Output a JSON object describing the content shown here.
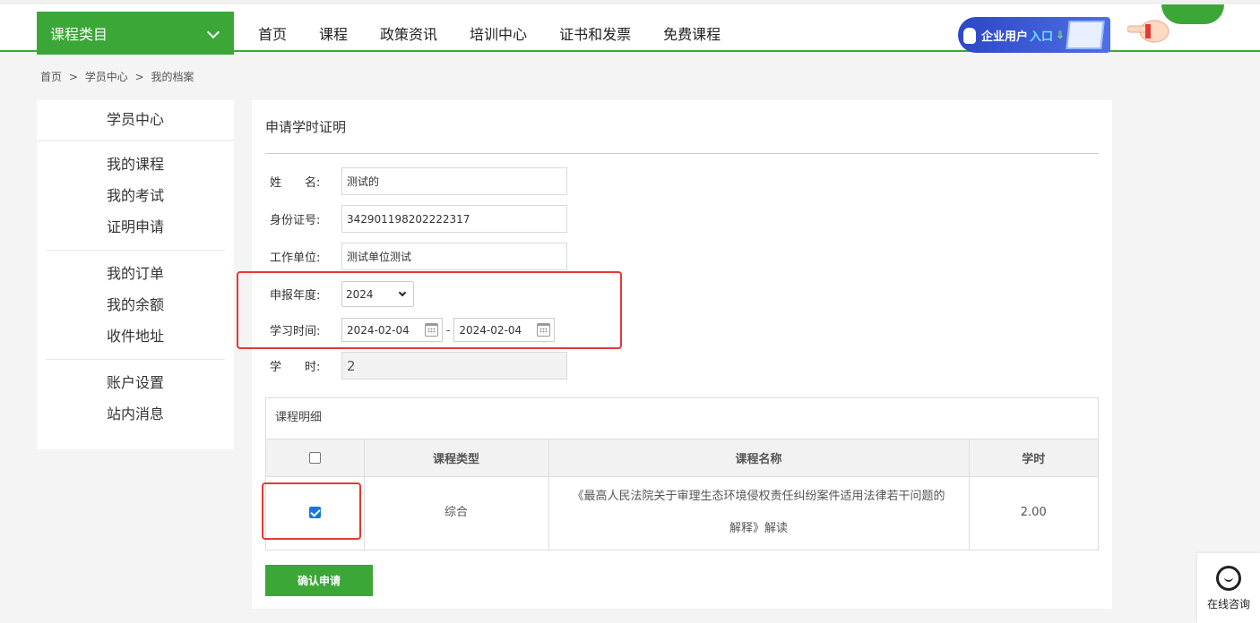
{
  "header": {
    "category_label": "课程类目",
    "nav": [
      "首页",
      "课程",
      "政策资讯",
      "培训中心",
      "证书和发票",
      "免费课程"
    ],
    "enterprise_text": "企业用户",
    "enterprise_entry": "入口",
    "accent": "#3ba737"
  },
  "breadcrumb": [
    "首页",
    ">",
    "学员中心",
    ">",
    "我的档案"
  ],
  "sidebar": {
    "title": "学员中心",
    "groups": [
      [
        "我的课程",
        "我的考试",
        "证明申请"
      ],
      [
        "我的订单",
        "我的余额",
        "收件地址"
      ],
      [
        "账户设置",
        "站内消息"
      ]
    ]
  },
  "form": {
    "title": "申请学时证明",
    "name_label": "姓　　名:",
    "name_value": "测试的",
    "id_label": "身份证号:",
    "id_value": "342901198202222317",
    "work_label": "工作单位:",
    "work_value": "测试单位测试",
    "year_label": "申报年度:",
    "year_value": "2024",
    "time_label": "学习时间:",
    "time_start": "2024-02-04",
    "time_end": "2024-02-04",
    "time_sep": "-",
    "hours_label": "学　　时:",
    "hours_value": "2"
  },
  "course_table": {
    "title": "课程明细",
    "headers": [
      "课程类型",
      "课程名称",
      "学时"
    ],
    "rows": [
      {
        "checked": true,
        "type": "综合",
        "name_line1": "《最高人民法院关于审理生态环境侵权责任纠纷案件适用法律若干问题的",
        "name_line2": "解释》解读",
        "hours": "2.00"
      }
    ]
  },
  "submit_label": "确认申请",
  "consult_label": "在线咨询"
}
